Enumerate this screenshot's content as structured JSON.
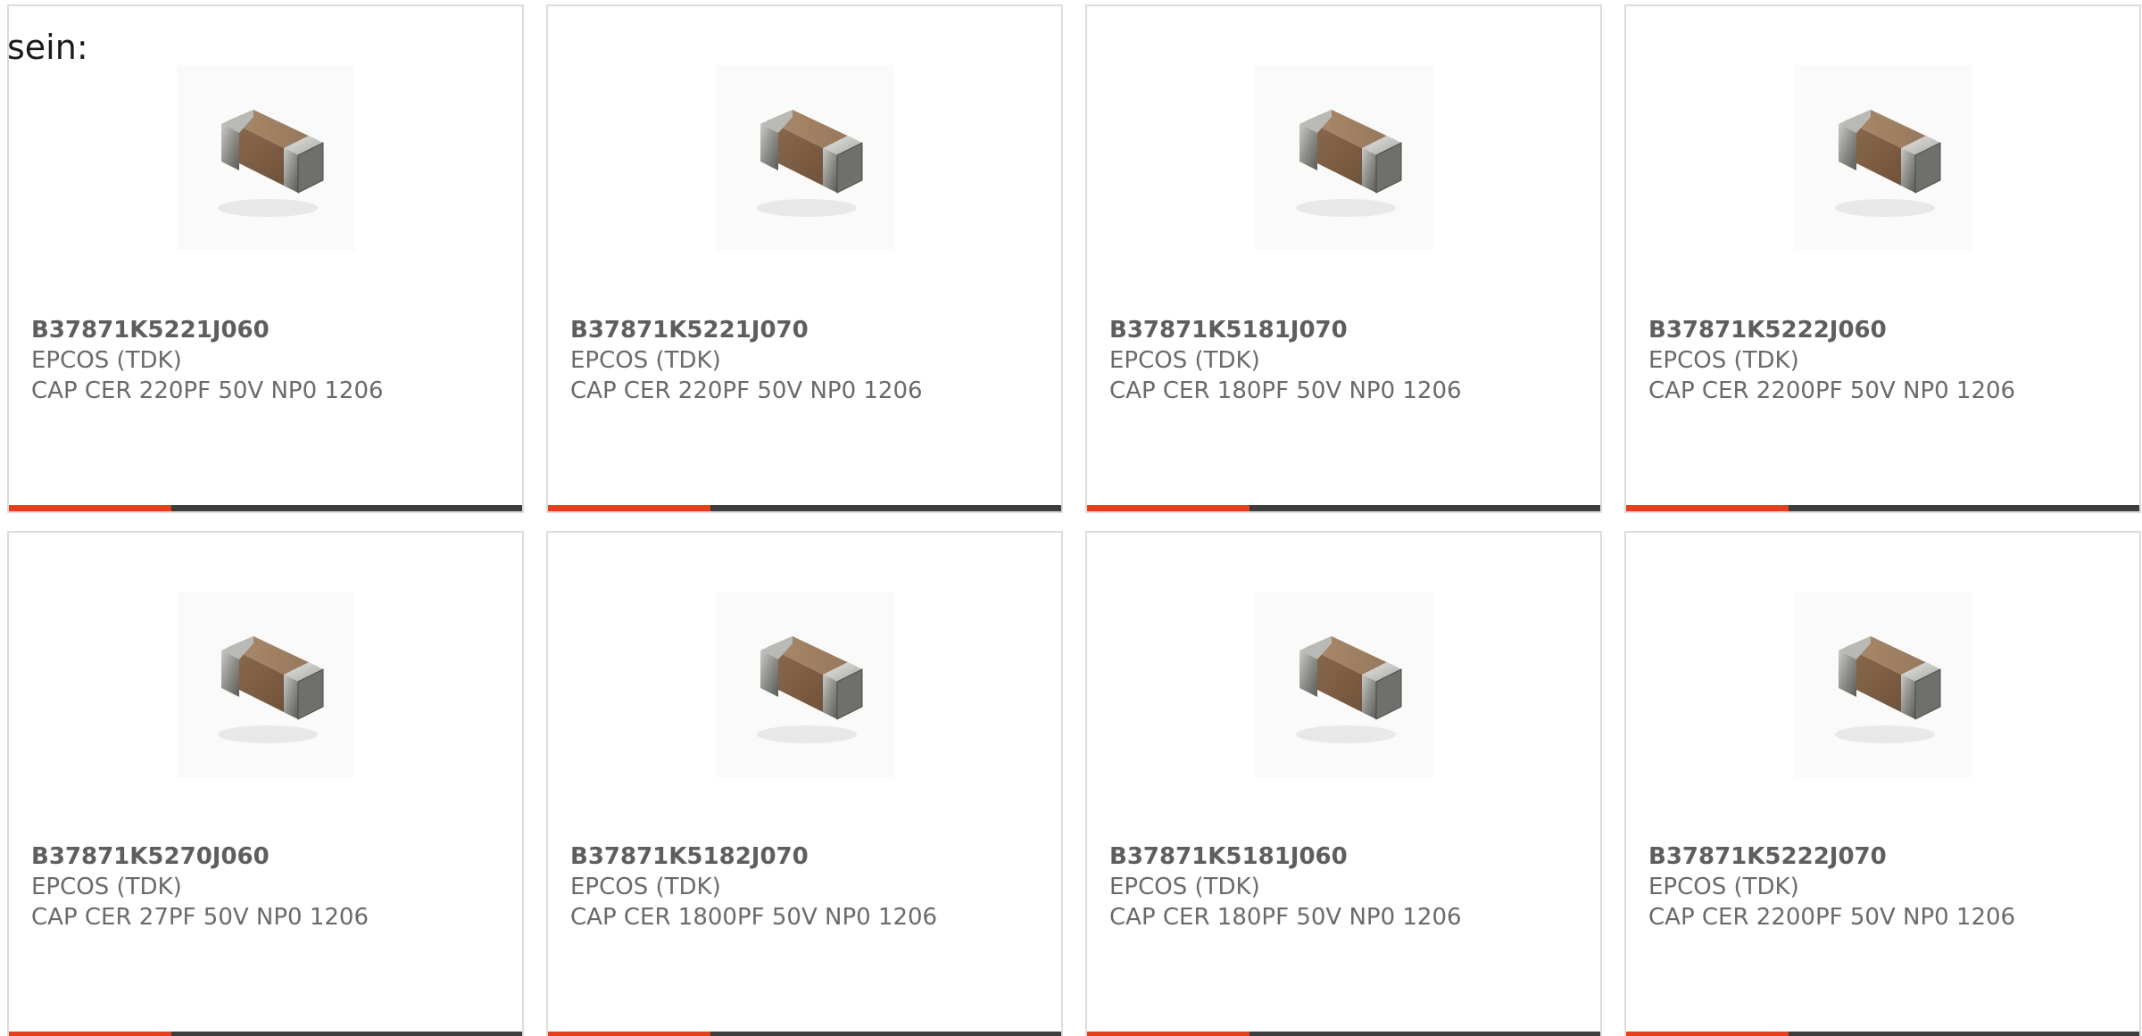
{
  "intro_text": "sein:",
  "colors": {
    "accent": "#e5401c",
    "bar": "#3d3d3d",
    "border": "#dcdcdc",
    "text": "#6a6a6a"
  },
  "products": [
    {
      "part_number": "B37871K5221J060",
      "manufacturer": "EPCOS (TDK)",
      "description": "CAP CER 220PF 50V NP0 1206",
      "image_icon": "ceramic-capacitor-icon"
    },
    {
      "part_number": "B37871K5221J070",
      "manufacturer": "EPCOS (TDK)",
      "description": "CAP CER 220PF 50V NP0 1206",
      "image_icon": "ceramic-capacitor-icon"
    },
    {
      "part_number": "B37871K5181J070",
      "manufacturer": "EPCOS (TDK)",
      "description": "CAP CER 180PF 50V NP0 1206",
      "image_icon": "ceramic-capacitor-icon"
    },
    {
      "part_number": "B37871K5222J060",
      "manufacturer": "EPCOS (TDK)",
      "description": "CAP CER 2200PF 50V NP0 1206",
      "image_icon": "ceramic-capacitor-icon"
    },
    {
      "part_number": "B37871K5270J060",
      "manufacturer": "EPCOS (TDK)",
      "description": "CAP CER 27PF 50V NP0 1206",
      "image_icon": "ceramic-capacitor-icon"
    },
    {
      "part_number": "B37871K5182J070",
      "manufacturer": "EPCOS (TDK)",
      "description": "CAP CER 1800PF 50V NP0 1206",
      "image_icon": "ceramic-capacitor-icon"
    },
    {
      "part_number": "B37871K5181J060",
      "manufacturer": "EPCOS (TDK)",
      "description": "CAP CER 180PF 50V NP0 1206",
      "image_icon": "ceramic-capacitor-icon"
    },
    {
      "part_number": "B37871K5222J070",
      "manufacturer": "EPCOS (TDK)",
      "description": "CAP CER 2200PF 50V NP0 1206",
      "image_icon": "ceramic-capacitor-icon"
    }
  ]
}
